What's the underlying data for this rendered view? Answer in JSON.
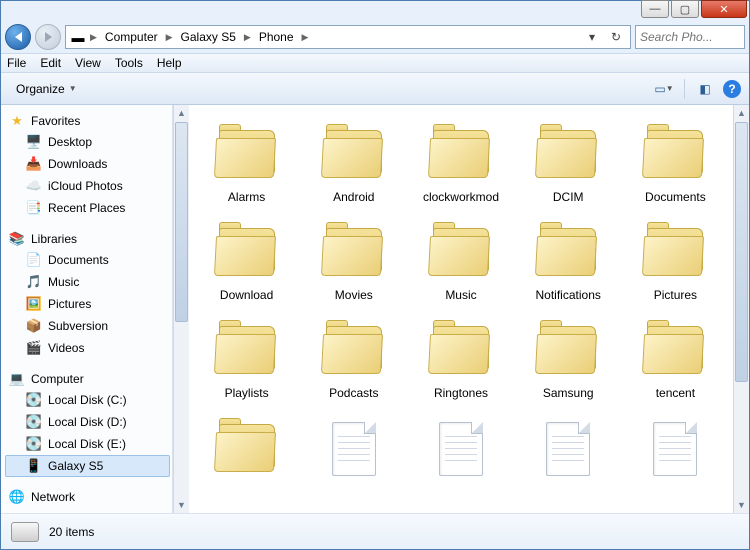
{
  "window": {
    "min_tip": "Minimize",
    "max_tip": "Maximize",
    "close_tip": "Close"
  },
  "breadcrumbs": [
    "Computer",
    "Galaxy S5",
    "Phone"
  ],
  "search": {
    "placeholder": "Search Pho..."
  },
  "menu": {
    "file": "File",
    "edit": "Edit",
    "view": "View",
    "tools": "Tools",
    "help": "Help"
  },
  "toolbar": {
    "organize": "Organize"
  },
  "sidebar": {
    "favorites": {
      "label": "Favorites",
      "items": [
        {
          "label": "Desktop",
          "icon": "🖥️"
        },
        {
          "label": "Downloads",
          "icon": "📥"
        },
        {
          "label": "iCloud Photos",
          "icon": "☁️"
        },
        {
          "label": "Recent Places",
          "icon": "📑"
        }
      ]
    },
    "libraries": {
      "label": "Libraries",
      "items": [
        {
          "label": "Documents",
          "icon": "📄"
        },
        {
          "label": "Music",
          "icon": "🎵"
        },
        {
          "label": "Pictures",
          "icon": "🖼️"
        },
        {
          "label": "Subversion",
          "icon": "📦"
        },
        {
          "label": "Videos",
          "icon": "🎬"
        }
      ]
    },
    "computer": {
      "label": "Computer",
      "items": [
        {
          "label": "Local Disk (C:)",
          "icon": "💽"
        },
        {
          "label": "Local Disk (D:)",
          "icon": "💽"
        },
        {
          "label": "Local Disk (E:)",
          "icon": "💽"
        },
        {
          "label": "Galaxy S5",
          "icon": "📱",
          "selected": true
        }
      ]
    },
    "network": {
      "label": "Network"
    }
  },
  "items": [
    {
      "name": "Alarms",
      "type": "folder"
    },
    {
      "name": "Android",
      "type": "folder"
    },
    {
      "name": "clockworkmod",
      "type": "folder"
    },
    {
      "name": "DCIM",
      "type": "folder"
    },
    {
      "name": "Documents",
      "type": "folder"
    },
    {
      "name": "Download",
      "type": "folder"
    },
    {
      "name": "Movies",
      "type": "folder"
    },
    {
      "name": "Music",
      "type": "folder"
    },
    {
      "name": "Notifications",
      "type": "folder"
    },
    {
      "name": "Pictures",
      "type": "folder"
    },
    {
      "name": "Playlists",
      "type": "folder"
    },
    {
      "name": "Podcasts",
      "type": "folder"
    },
    {
      "name": "Ringtones",
      "type": "folder"
    },
    {
      "name": "Samsung",
      "type": "folder"
    },
    {
      "name": "tencent",
      "type": "folder"
    },
    {
      "name": "",
      "type": "folder"
    },
    {
      "name": "",
      "type": "file"
    },
    {
      "name": "",
      "type": "file"
    },
    {
      "name": "",
      "type": "file"
    },
    {
      "name": "",
      "type": "file"
    }
  ],
  "status": {
    "count": "20 items"
  }
}
